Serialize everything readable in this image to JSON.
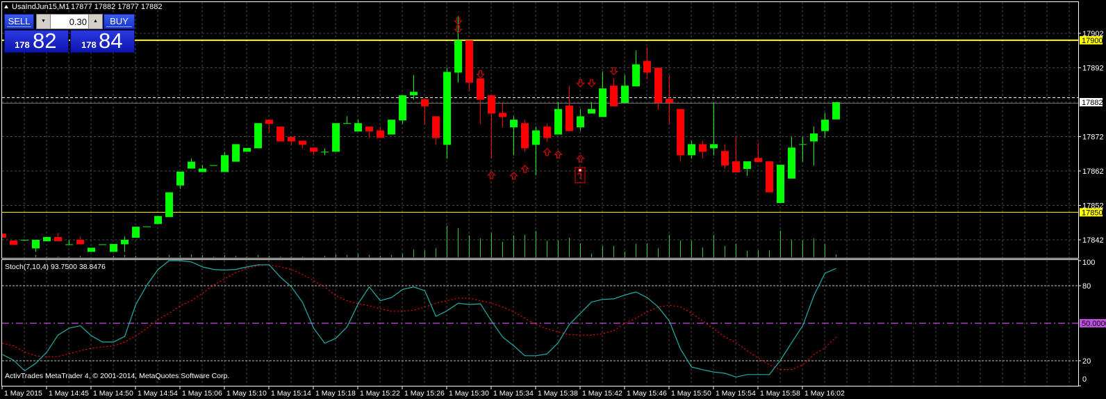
{
  "window": {
    "symbol_timeframe": "UsaIndJun15,M1",
    "ohlc_readout": "17877 17882 17877 17882"
  },
  "trade_panel": {
    "sell_label": "SELL",
    "buy_label": "BUY",
    "lot_value": "0.30",
    "sell_price_prefix": "178",
    "sell_price_big": "82",
    "buy_price_prefix": "178",
    "buy_price_big": "84"
  },
  "price_axis": {
    "ticks": [
      "17902",
      "17892",
      "17872",
      "17862",
      "17852",
      "17842"
    ],
    "tick_values": [
      17902,
      17892,
      17872,
      17862,
      17852,
      17842
    ],
    "level_labels": [
      "17900",
      "17850"
    ],
    "level_values": [
      17900,
      17850
    ],
    "current_label": "17882",
    "current_value": 17882
  },
  "indicator": {
    "label": "Stoch(7,10,4) 93.7500 38.8476",
    "axis_ticks": [
      "100",
      "80",
      "20",
      "0"
    ],
    "axis_values": [
      100,
      80,
      20,
      0
    ],
    "mid_label": "50.0000",
    "mid_value": 50
  },
  "footer": {
    "copyright": "ActivTrades MetaTrader 4, © 2001-2014, MetaQuotes Software Corp."
  },
  "time_axis": {
    "labels": [
      "1 May 2015",
      "1 May 14:45",
      "1 May 14:50",
      "1 May 14:54",
      "1 May 15:06",
      "1 May 15:10",
      "1 May 15:14",
      "1 May 15:18",
      "1 May 15:22",
      "1 May 15:26",
      "1 May 15:30",
      "1 May 15:34",
      "1 May 15:38",
      "1 May 15:42",
      "1 May 15:46",
      "1 May 15:50",
      "1 May 15:54",
      "1 May 15:58",
      "1 May 16:02"
    ],
    "bars_per_label": 4
  },
  "colors": {
    "bull": "#00ff00",
    "bear": "#ff0000",
    "level": "#ffff00",
    "grid": "#4a4a4a",
    "stoch_main": "#20b2aa",
    "stoch_signal": "#ff0000",
    "mid_level": "#c050e0",
    "arrow": "#d00000"
  },
  "chart_data": {
    "type": "candlestick",
    "fields": [
      "open",
      "high",
      "low",
      "close"
    ],
    "ohlc": [
      [
        17843.8,
        17843.8,
        17842.6,
        17842.6
      ],
      [
        17841.8,
        17841.8,
        17840.5,
        17840.5
      ],
      [
        17842,
        17842,
        17842,
        17842
      ],
      [
        17839.5,
        17842,
        17838.5,
        17842
      ],
      [
        17841.6,
        17842.8,
        17841.6,
        17842.8
      ],
      [
        17842.8,
        17844,
        17841.6,
        17841.6
      ],
      [
        17840.7,
        17842,
        17840.7,
        17840.7
      ],
      [
        17842,
        17843,
        17840.7,
        17840.7
      ],
      [
        17838.5,
        17839.7,
        17838.5,
        17839.7
      ],
      [
        17840.7,
        17840.7,
        17840.7,
        17840.7
      ],
      [
        17838.5,
        17840.8,
        17838.5,
        17840.8
      ],
      [
        17840.7,
        17843,
        17838.5,
        17842
      ],
      [
        17842.6,
        17845.8,
        17842.6,
        17845.8
      ],
      [
        17845.9,
        17845.9,
        17845.9,
        17845.9
      ],
      [
        17846.6,
        17848.9,
        17846.6,
        17848.9
      ],
      [
        17848.6,
        17855.8,
        17848.6,
        17855.8
      ],
      [
        17857.8,
        17861.8,
        17856.8,
        17861.8
      ],
      [
        17862.7,
        17865.7,
        17862.7,
        17864.7
      ],
      [
        17861.7,
        17863.7,
        17861.7,
        17862.7
      ],
      [
        17863.7,
        17863.7,
        17863.7,
        17863.7
      ],
      [
        17861.7,
        17867.6,
        17861.7,
        17866.6
      ],
      [
        17864.7,
        17869.8,
        17864.7,
        17869.8
      ],
      [
        17867.6,
        17868.7,
        17867.6,
        17868.7
      ],
      [
        17868.6,
        17875.9,
        17868.6,
        17875.9
      ],
      [
        17876.9,
        17876.9,
        17873.2,
        17875.7
      ],
      [
        17874.9,
        17874.9,
        17870.6,
        17870.6
      ],
      [
        17871.9,
        17871.9,
        17869.6,
        17870.6
      ],
      [
        17870.8,
        17870.8,
        17868.6,
        17869.6
      ],
      [
        17868.8,
        17868.8,
        17866.6,
        17867.6
      ],
      [
        17867.6,
        17868.6,
        17866.6,
        17867.6
      ],
      [
        17867.6,
        17875.9,
        17867.6,
        17875.9
      ],
      [
        17875.9,
        17877.9,
        17875.9,
        17875.9
      ],
      [
        17873.5,
        17876.9,
        17873.5,
        17875.9
      ],
      [
        17874.9,
        17874.9,
        17871.6,
        17873.5
      ],
      [
        17873.8,
        17874.9,
        17871.6,
        17871.6
      ],
      [
        17872.6,
        17876.9,
        17872.6,
        17876.9
      ],
      [
        17876.7,
        17884,
        17875.7,
        17884
      ],
      [
        17884,
        17889.9,
        17882.7,
        17885
      ],
      [
        17882.9,
        17882.9,
        17875.5,
        17880.8
      ],
      [
        17877.9,
        17877.9,
        17869.6,
        17871.6
      ],
      [
        17869.6,
        17892,
        17865.6,
        17890.8
      ],
      [
        17890.6,
        17907,
        17887.7,
        17900
      ],
      [
        17900,
        17900,
        17885.4,
        17887.7
      ],
      [
        17888.9,
        17888.9,
        17875.7,
        17882.7
      ],
      [
        17884,
        17884,
        17865.6,
        17878.7
      ],
      [
        17878.9,
        17881.7,
        17874.7,
        17877.7
      ],
      [
        17874.7,
        17877.9,
        17866.6,
        17876.9
      ],
      [
        17875.9,
        17876.9,
        17867.6,
        17868.6
      ],
      [
        17869.6,
        17874.9,
        17860.8,
        17873.8
      ],
      [
        17874.9,
        17875.9,
        17870.5,
        17871.6
      ],
      [
        17872.6,
        17882,
        17872.6,
        17880
      ],
      [
        17881,
        17886.8,
        17873.6,
        17873.6
      ],
      [
        17874.7,
        17880,
        17873.6,
        17877.9
      ],
      [
        17878.7,
        17882,
        17878.7,
        17880
      ],
      [
        17877.7,
        17890.9,
        17877.7,
        17886
      ],
      [
        17886.8,
        17888.9,
        17880.8,
        17880.8
      ],
      [
        17881.8,
        17889.9,
        17881.8,
        17886.8
      ],
      [
        17886.6,
        17897,
        17886.6,
        17893
      ],
      [
        17894,
        17898,
        17888.7,
        17890.6
      ],
      [
        17892,
        17892,
        17879.8,
        17881.8
      ],
      [
        17883,
        17889.9,
        17875.7,
        17881.8
      ],
      [
        17880,
        17880,
        17864.7,
        17866.6
      ],
      [
        17866.6,
        17870.8,
        17865.6,
        17869.8
      ],
      [
        17869.8,
        17870.8,
        17865.6,
        17867.6
      ],
      [
        17868.6,
        17882,
        17866.6,
        17869.8
      ],
      [
        17867.8,
        17869.8,
        17862.7,
        17863.6
      ],
      [
        17864.8,
        17871.9,
        17861.6,
        17861.6
      ],
      [
        17862.6,
        17864.8,
        17860.6,
        17864.8
      ],
      [
        17865.8,
        17870,
        17864.6,
        17864.6
      ],
      [
        17864.8,
        17864.8,
        17855.8,
        17855.8
      ],
      [
        17852.7,
        17863.8,
        17852.7,
        17863.8
      ],
      [
        17859.8,
        17871.9,
        17859.8,
        17868.8
      ],
      [
        17869.8,
        17871.9,
        17864.7,
        17869.8
      ],
      [
        17870.6,
        17874.9,
        17863.6,
        17872.9
      ],
      [
        17873.6,
        17878.9,
        17871.6,
        17876.9
      ],
      [
        17877,
        17882,
        17877,
        17882
      ]
    ],
    "volume": [
      0,
      0,
      0,
      9,
      3,
      3,
      3,
      6,
      0,
      0,
      6,
      9,
      6,
      0,
      3,
      9,
      9,
      12,
      9,
      3,
      9,
      6,
      3,
      9,
      6,
      3,
      3,
      3,
      0,
      6,
      12,
      9,
      15,
      9,
      6,
      9,
      15,
      33,
      30,
      39,
      135,
      126,
      94,
      81,
      105,
      66,
      94,
      96,
      113,
      70,
      72,
      84,
      60,
      15,
      48,
      48,
      24,
      57,
      60,
      39,
      96,
      72,
      70,
      42,
      96,
      48,
      58,
      27,
      30,
      30,
      114,
      75,
      72,
      81,
      58,
      12
    ],
    "stoch_main": [
      25,
      20.5,
      12,
      18,
      27,
      40.5,
      46,
      48,
      40,
      35,
      35,
      39.5,
      65,
      80.5,
      93,
      100,
      100,
      99,
      95,
      93,
      92.5,
      93,
      95,
      96.7,
      96.7,
      87,
      79,
      66.7,
      46,
      34,
      38,
      47,
      65.5,
      79,
      68,
      70.5,
      77,
      79,
      76,
      55.5,
      60,
      66,
      65,
      65.5,
      51.7,
      39,
      32,
      24,
      24,
      25.5,
      34.5,
      49,
      58,
      67,
      69,
      69.5,
      72.5,
      75,
      70.5,
      63,
      51.7,
      29.4,
      15,
      12.8,
      11,
      10,
      7,
      9,
      9,
      9,
      20.5,
      34.5,
      48,
      72,
      90,
      93.75
    ],
    "stoch_signal": [
      34,
      32,
      27,
      24,
      23,
      23.5,
      25.5,
      28,
      30,
      31,
      32,
      35,
      40,
      46,
      53,
      58,
      64,
      68,
      74,
      80.5,
      85.5,
      90.5,
      94,
      96,
      96.7,
      95,
      93,
      89,
      84,
      79,
      72,
      68,
      65.5,
      64,
      61.6,
      59.5,
      59.5,
      60.5,
      63,
      66,
      68,
      70,
      70,
      68,
      66,
      63,
      59,
      54,
      49,
      45.5,
      43,
      41,
      40.5,
      40.5,
      41.6,
      44,
      50,
      54,
      59,
      63,
      64.4,
      63,
      58,
      51.7,
      45.5,
      39,
      34.5,
      28,
      22,
      16.7,
      13,
      13,
      16.7,
      25,
      30.5,
      38.85
    ],
    "signal_arrows": [
      {
        "bar": 41,
        "type": "down",
        "price": 17905.6
      },
      {
        "bar": 41,
        "type": "down",
        "price": 17903.2
      },
      {
        "bar": 43,
        "type": "down",
        "price": 17890.1
      },
      {
        "bar": 52,
        "type": "down",
        "price": 17887.5
      },
      {
        "bar": 53,
        "type": "down",
        "price": 17887.5
      },
      {
        "bar": 55,
        "type": "down",
        "price": 17891
      },
      {
        "bar": 44,
        "type": "up",
        "price": 17860.8
      },
      {
        "bar": 46,
        "type": "up",
        "price": 17860.6
      },
      {
        "bar": 47,
        "type": "up",
        "price": 17862.6
      },
      {
        "bar": 49,
        "type": "up",
        "price": 17867.5
      },
      {
        "bar": 50,
        "type": "up",
        "price": 17866.8
      },
      {
        "bar": 52,
        "type": "up",
        "price": 17865.6
      }
    ],
    "marker": {
      "bar": 52,
      "price": 17860.8
    },
    "price_range": [
      17842,
      17902
    ],
    "stoch_range": [
      0,
      100
    ]
  }
}
